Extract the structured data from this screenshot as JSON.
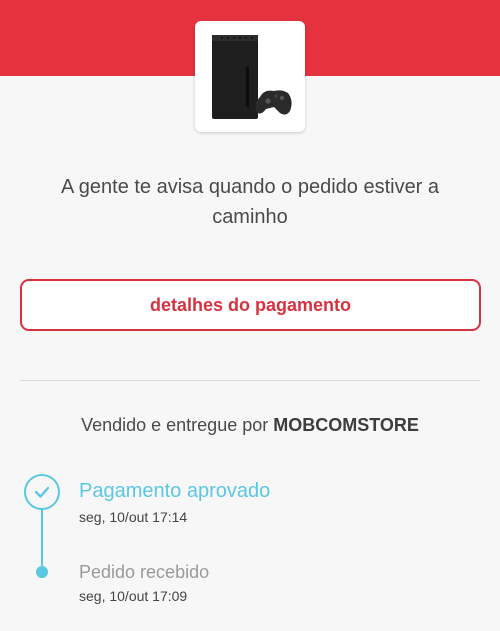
{
  "message": "A gente te avisa quando o pedido estiver a caminho",
  "details_button": "detalhes do pagamento",
  "seller": {
    "prefix": "Vendido e entregue por ",
    "name": "MOBCOMSTORE"
  },
  "timeline": [
    {
      "title": "Pagamento aprovado",
      "time": "seg, 10/out 17:14",
      "icon": "check-icon"
    },
    {
      "title": "Pedido recebido",
      "time": "seg, 10/out 17:09",
      "icon": "dot-icon"
    }
  ],
  "colors": {
    "brand_red": "#e4323e",
    "button_red": "#d6323f",
    "accent_blue": "#5ac8e0"
  },
  "product_image": "xbox-console-image"
}
